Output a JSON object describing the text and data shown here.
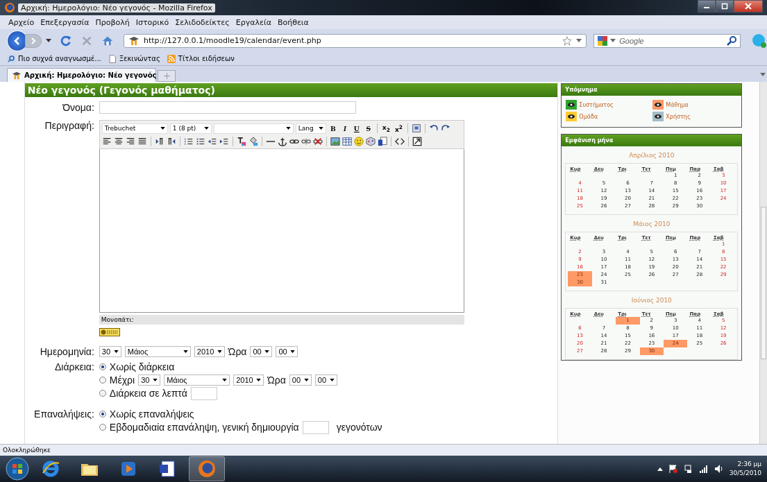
{
  "window": {
    "title": "Αρχική: Ημερολόγιο: Νέο γεγονός - Mozilla Firefox"
  },
  "menu": [
    "Αρχείο",
    "Επεξεργασία",
    "Προβολή",
    "Ιστορικό",
    "Σελιδοδείκτες",
    "Εργαλεία",
    "Βοήθεια"
  ],
  "address": {
    "url": "http://127.0.0.1/moodle19/calendar/event.php"
  },
  "search": {
    "placeholder": "Google"
  },
  "bookmarks": [
    "Πιο συχνά αναγνωσμέ...",
    "Ξεκινώντας",
    "Τίτλοι ειδήσεων"
  ],
  "tabs": [
    {
      "label": "Αρχική: Ημερολόγιο: Νέο γεγονός",
      "selected": true
    }
  ],
  "form": {
    "heading": "Νέο γεγονός (Γεγονός μαθήματος)",
    "name_label": "Όνομα:",
    "description_label": "Περιγραφή:",
    "editor": {
      "font": "Trebuchet",
      "size": "1 (8 pt)",
      "lang": "Lang",
      "bold": "B",
      "italic": "I",
      "underline": "U",
      "strike": "S",
      "subscript": "x$_{2}$",
      "superscript": "x$^{2}$",
      "path_label": "Μονοπάτι:"
    },
    "date": {
      "label": "Ημερομηνία:",
      "day": "30",
      "month": "Μάιος",
      "year": "2010",
      "time_label": "Ώρα",
      "hour": "00",
      "minute": "00"
    },
    "duration": {
      "label": "Διάρκεια:",
      "options": [
        {
          "kind": "plain",
          "label": "Χωρίς διάρκεια",
          "selected": true
        },
        {
          "kind": "until",
          "label": "Μέχρι",
          "day": "30",
          "month": "Μάιος",
          "year": "2010",
          "time_label": "Ώρα",
          "hour": "00",
          "minute": "00",
          "selected": false
        },
        {
          "kind": "minutes",
          "label": "Διάρκεια σε λεπτά",
          "selected": false
        }
      ]
    },
    "repeat": {
      "label": "Επαναλήψεις:",
      "options": [
        {
          "kind": "plain",
          "label": "Χωρίς επαναλήψεις",
          "selected": true
        },
        {
          "kind": "weekly",
          "label": "Εβδομαδιαία επανάληψη, γενική δημιουργία",
          "suffix": "γεγονότων",
          "selected": false
        }
      ]
    }
  },
  "legend": {
    "title": "Υπόμνημα",
    "items": [
      {
        "label": "Συστήματος",
        "color": "#2fa52f"
      },
      {
        "label": "Μάθημα",
        "color": "#ff9966"
      },
      {
        "label": "Ομάδα",
        "color": "#ffcc33"
      },
      {
        "label": "Χρήστης",
        "color": "#a3bcc8"
      }
    ]
  },
  "month_view": {
    "title": "Εμφάνιση μήνα",
    "months": [
      {
        "name": "Απρίλιος 2010",
        "weekdays": [
          "Κυρ",
          "Δευ",
          "Τρι",
          "Τετ",
          "Πεμ",
          "Παρ",
          "Σαβ"
        ],
        "weeks": [
          {
            "align_end": true,
            "days": [
              {
                "d": "1",
                "event": false
              },
              {
                "d": "2",
                "event": false
              },
              {
                "d": "3",
                "event": false
              }
            ]
          },
          {
            "days": [
              {
                "d": "4",
                "event": false
              },
              {
                "d": "5",
                "event": false
              },
              {
                "d": "6",
                "event": false
              },
              {
                "d": "7",
                "event": false
              },
              {
                "d": "8",
                "event": false
              },
              {
                "d": "9",
                "event": false
              },
              {
                "d": "10",
                "event": false
              }
            ]
          },
          {
            "days": [
              {
                "d": "11",
                "event": false
              },
              {
                "d": "12",
                "event": false
              },
              {
                "d": "13",
                "event": false
              },
              {
                "d": "14",
                "event": false
              },
              {
                "d": "15",
                "event": false
              },
              {
                "d": "16",
                "event": false
              },
              {
                "d": "17",
                "event": false
              }
            ]
          },
          {
            "days": [
              {
                "d": "18",
                "event": false
              },
              {
                "d": "19",
                "event": false
              },
              {
                "d": "20",
                "event": false
              },
              {
                "d": "21",
                "event": false
              },
              {
                "d": "22",
                "event": false
              },
              {
                "d": "23",
                "event": false
              },
              {
                "d": "24",
                "event": false
              }
            ]
          },
          {
            "days": [
              {
                "d": "25",
                "event": false
              },
              {
                "d": "26",
                "event": false
              },
              {
                "d": "27",
                "event": false
              },
              {
                "d": "28",
                "event": false
              },
              {
                "d": "29",
                "event": false
              },
              {
                "d": "30",
                "event": false
              }
            ]
          }
        ]
      },
      {
        "name": "Μάιος 2010",
        "weekdays": [
          "Κυρ",
          "Δευ",
          "Τρι",
          "Τετ",
          "Πεμ",
          "Παρ",
          "Σαβ"
        ],
        "weeks": [
          {
            "align_end": true,
            "days": [
              {
                "d": "1",
                "event": false
              }
            ]
          },
          {
            "days": [
              {
                "d": "2",
                "event": false
              },
              {
                "d": "3",
                "event": false
              },
              {
                "d": "4",
                "event": false
              },
              {
                "d": "5",
                "event": false
              },
              {
                "d": "6",
                "event": false
              },
              {
                "d": "7",
                "event": false
              },
              {
                "d": "8",
                "event": false
              }
            ]
          },
          {
            "days": [
              {
                "d": "9",
                "event": false
              },
              {
                "d": "10",
                "event": false
              },
              {
                "d": "11",
                "event": false
              },
              {
                "d": "12",
                "event": false
              },
              {
                "d": "13",
                "event": false
              },
              {
                "d": "14",
                "event": false
              },
              {
                "d": "15",
                "event": false
              }
            ]
          },
          {
            "days": [
              {
                "d": "16",
                "event": false
              },
              {
                "d": "17",
                "event": false
              },
              {
                "d": "18",
                "event": false
              },
              {
                "d": "19",
                "event": false
              },
              {
                "d": "20",
                "event": false
              },
              {
                "d": "21",
                "event": false
              },
              {
                "d": "22",
                "event": false
              }
            ]
          },
          {
            "days": [
              {
                "d": "23",
                "event": true
              },
              {
                "d": "24",
                "event": false
              },
              {
                "d": "25",
                "event": false
              },
              {
                "d": "26",
                "event": false
              },
              {
                "d": "27",
                "event": false
              },
              {
                "d": "28",
                "event": false
              },
              {
                "d": "29",
                "event": false
              }
            ]
          },
          {
            "days": [
              {
                "d": "30",
                "event": true
              },
              {
                "d": "31",
                "event": false
              }
            ]
          }
        ]
      },
      {
        "name": "Ιούνιος 2010",
        "weekdays": [
          "Κυρ",
          "Δευ",
          "Τρι",
          "Τετ",
          "Πεμ",
          "Παρ",
          "Σαβ"
        ],
        "weeks": [
          {
            "align_end": true,
            "days": [
              {
                "d": "1",
                "event": true
              },
              {
                "d": "2",
                "event": false
              },
              {
                "d": "3",
                "event": false
              },
              {
                "d": "4",
                "event": false
              },
              {
                "d": "5",
                "event": false
              }
            ]
          },
          {
            "days": [
              {
                "d": "6",
                "event": false
              },
              {
                "d": "7",
                "event": false
              },
              {
                "d": "8",
                "event": false
              },
              {
                "d": "9",
                "event": false
              },
              {
                "d": "10",
                "event": false
              },
              {
                "d": "11",
                "event": false
              },
              {
                "d": "12",
                "event": false
              }
            ]
          },
          {
            "days": [
              {
                "d": "13",
                "event": false
              },
              {
                "d": "14",
                "event": false
              },
              {
                "d": "15",
                "event": false
              },
              {
                "d": "16",
                "event": false
              },
              {
                "d": "17",
                "event": false
              },
              {
                "d": "18",
                "event": false
              },
              {
                "d": "19",
                "event": false
              }
            ]
          },
          {
            "days": [
              {
                "d": "20",
                "event": false
              },
              {
                "d": "21",
                "event": false
              },
              {
                "d": "22",
                "event": false
              },
              {
                "d": "23",
                "event": false
              },
              {
                "d": "24",
                "event": true
              },
              {
                "d": "25",
                "event": false
              },
              {
                "d": "26",
                "event": false
              }
            ]
          },
          {
            "days": [
              {
                "d": "27",
                "event": false
              },
              {
                "d": "28",
                "event": false
              },
              {
                "d": "29",
                "event": false
              },
              {
                "d": "30",
                "event": true
              }
            ]
          }
        ]
      }
    ]
  },
  "status_bar": {
    "text": "Ολοκληρώθηκε"
  },
  "taskbar": {
    "time": "2:36 μμ",
    "date": "30/5/2010"
  }
}
